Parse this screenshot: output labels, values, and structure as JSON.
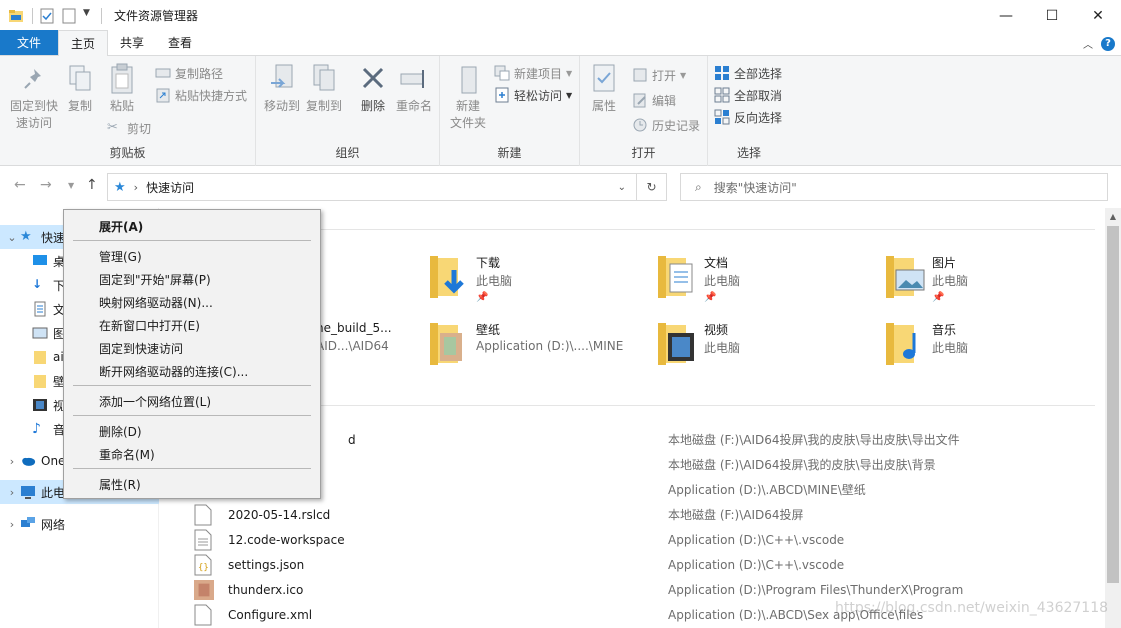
{
  "window": {
    "title": "文件资源管理器"
  },
  "tabs": [
    {
      "label": "文件"
    },
    {
      "label": "主页"
    },
    {
      "label": "共享"
    },
    {
      "label": "查看"
    }
  ],
  "ribbon": {
    "clipboard": {
      "label": "剪贴板",
      "pin_quick_access": "固定到快\n速访问",
      "copy": "复制",
      "paste": "粘贴",
      "copy_path": "复制路径",
      "paste_shortcut": "粘贴快捷方式",
      "cut": "剪切"
    },
    "organize": {
      "label": "组织",
      "move_to": "移动到",
      "copy_to": "复制到",
      "delete": "删除",
      "rename": "重命名"
    },
    "new": {
      "label": "新建",
      "new_folder": "新建\n文件夹",
      "new_item": "新建项目",
      "easy_access": "轻松访问"
    },
    "open": {
      "label": "打开",
      "properties": "属性",
      "open": "打开",
      "edit": "编辑",
      "history": "历史记录"
    },
    "select": {
      "label": "选择",
      "select_all": "全部选择",
      "select_none": "全部取消",
      "invert": "反向选择"
    }
  },
  "address": {
    "path": "快速访问",
    "search_placeholder": "搜索\"快速访问\""
  },
  "sidebar": {
    "items": [
      {
        "label": "快速访问",
        "icon": "star-icon"
      },
      {
        "label": "桌面",
        "icon": "desktop-icon"
      },
      {
        "label": "下载",
        "icon": "download-icon"
      },
      {
        "label": "文档",
        "icon": "document-icon"
      },
      {
        "label": "图片",
        "icon": "picture-icon"
      },
      {
        "label": "ai",
        "icon": "folder-icon"
      },
      {
        "label": "壁",
        "icon": "folder-icon"
      },
      {
        "label": "视",
        "icon": "video-icon"
      },
      {
        "label": "音",
        "icon": "music-icon"
      },
      {
        "label": "OneDrive",
        "icon": "cloud-icon"
      },
      {
        "label": "此电脑",
        "icon": "computer-icon"
      },
      {
        "label": "网络",
        "icon": "network-icon"
      }
    ]
  },
  "tiles": [
    {
      "name": "下载",
      "sub": "此电脑",
      "icon": "download-folder-icon"
    },
    {
      "name": "文档",
      "sub": "此电脑",
      "icon": "documents-folder-icon"
    },
    {
      "name": "图片",
      "sub": "此电脑",
      "icon": "pictures-folder-icon"
    },
    {
      "name": "ne_build_5...",
      "sub": "AID...\\AID64",
      "icon": "folder-icon"
    },
    {
      "name": "壁纸",
      "sub": "Application (D:)\\....\\MINE",
      "icon": "wallpaper-folder-icon"
    },
    {
      "name": "视频",
      "sub": "此电脑",
      "icon": "videos-folder-icon"
    },
    {
      "name": "音乐",
      "sub": "此电脑",
      "icon": "music-folder-icon"
    }
  ],
  "recent_files": [
    {
      "name": "d",
      "path": "本地磁盘 (F:)\\AID64投屏\\我的皮肤\\导出皮肤\\导出文件"
    },
    {
      "name": "",
      "path": "本地磁盘 (F:)\\AID64投屏\\我的皮肤\\导出皮肤\\背景"
    },
    {
      "name": "",
      "path": "Application (D:)\\.ABCD\\MINE\\壁纸"
    },
    {
      "name": "2020-05-14.rslcd",
      "path": "本地磁盘 (F:)\\AID64投屏"
    },
    {
      "name": "12.code-workspace",
      "path": "Application (D:)\\C++\\.vscode"
    },
    {
      "name": "settings.json",
      "path": "Application (D:)\\C++\\.vscode"
    },
    {
      "name": "thunderx.ico",
      "path": "Application (D:)\\Program Files\\ThunderX\\Program"
    },
    {
      "name": "Configure.xml",
      "path": "Application (D:)\\.ABCD\\Sex app\\Office\\files"
    }
  ],
  "context_menu": {
    "expand": "展开(A)",
    "manage": "管理(G)",
    "pin_start": "固定到\"开始\"屏幕(P)",
    "map_drive": "映射网络驱动器(N)...",
    "open_new_window": "在新窗口中打开(E)",
    "pin_quick": "固定到快速访问",
    "disconnect_drive": "断开网络驱动器的连接(C)...",
    "add_network_location": "添加一个网络位置(L)",
    "delete": "删除(D)",
    "rename": "重命名(M)",
    "properties": "属性(R)"
  },
  "watermark": "https://blog.csdn.net/weixin_43627118",
  "colors": {
    "accent": "#1979ca",
    "selection": "#cce8ff",
    "folder": "#f8d775"
  }
}
